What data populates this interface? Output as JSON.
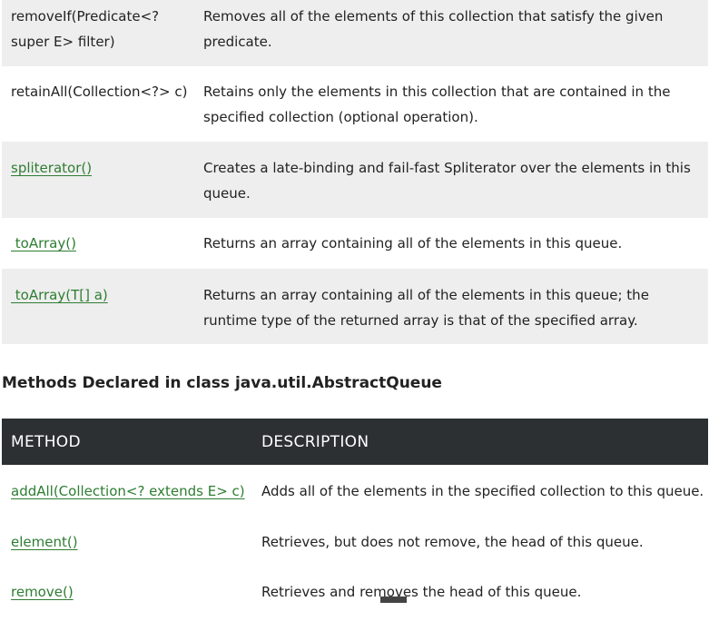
{
  "methods_table": {
    "rows": [
      {
        "method": "removeIf(Predicate<? super E> filter)",
        "description": "Removes all of the elements of this collection that satisfy the given predicate."
      },
      {
        "method": "retainAll(Collection<?> c)",
        "description": "Retains only the elements in this collection that are contained in the specified collection (optional operation)."
      },
      {
        "method": "spliterator()",
        "description": "Creates a late-binding and fail-fast Spliterator over the elements in this queue."
      },
      {
        "method": " toArray()",
        "description": "Returns an array containing all of the elements in this queue."
      },
      {
        "method": " toArray(T[] a)",
        "description": "Returns an array containing all of the elements in this queue; the runtime type of the returned array is that of the specified array."
      }
    ]
  },
  "section_heading": "Methods Declared in class java.util.AbstractQueue",
  "abstract_queue_table": {
    "headers": {
      "method": "METHOD",
      "description": "DESCRIPTION"
    },
    "rows": [
      {
        "method": "addAll(Collection<? extends E> c)",
        "description": "Adds all of the elements in the specified collection to this queue."
      },
      {
        "method": "element()",
        "description": "Retrieves, but does not remove, the head of this queue."
      },
      {
        "method": "remove()",
        "description": "Retrieves and removes the head of this queue."
      }
    ]
  },
  "colors": {
    "link": "#2e7d32",
    "header_bg": "#2c3033",
    "row_shade": "#eeeeee"
  }
}
